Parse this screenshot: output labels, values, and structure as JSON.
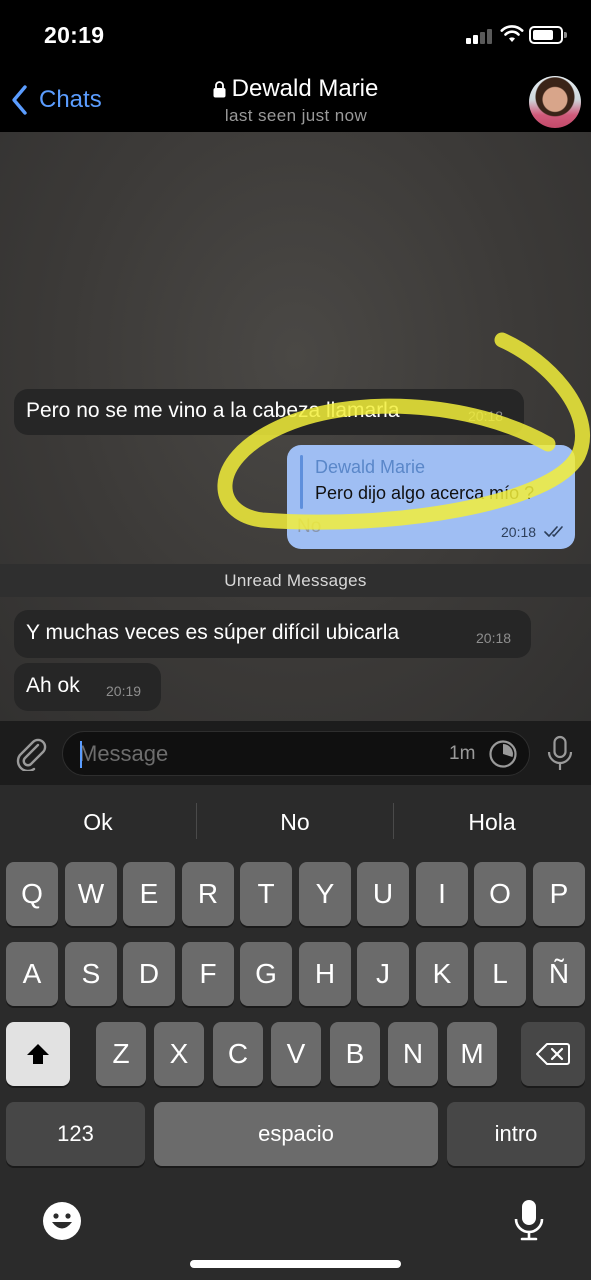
{
  "status_bar": {
    "time": "20:19"
  },
  "nav": {
    "back_label": "Chats",
    "contact_name": "Dewald Marie",
    "last_seen": "last seen just now"
  },
  "messages": [
    {
      "direction": "incoming",
      "text": "Pero no se me vino a la cabeza llamarla",
      "time": "20:18"
    },
    {
      "direction": "outgoing",
      "reply_to_name": "Dewald Marie",
      "reply_to_text": "Pero dijo algo acerca mío ?",
      "text": "No",
      "time": "20:18",
      "status": "read"
    },
    {
      "direction": "incoming",
      "text": "Y muchas veces es súper difícil ubicarla",
      "time": "20:18"
    },
    {
      "direction": "incoming",
      "text": "Ah ok",
      "time": "20:19"
    }
  ],
  "unread_divider": "Unread Messages",
  "composer": {
    "placeholder": "Message",
    "timer_label": "1m"
  },
  "keyboard": {
    "suggestions": [
      "Ok",
      "No",
      "Hola"
    ],
    "row1": [
      "Q",
      "W",
      "E",
      "R",
      "T",
      "Y",
      "U",
      "I",
      "O",
      "P"
    ],
    "row2": [
      "A",
      "S",
      "D",
      "F",
      "G",
      "H",
      "J",
      "K",
      "L",
      "Ñ"
    ],
    "row3": [
      "Z",
      "X",
      "C",
      "V",
      "B",
      "N",
      "M"
    ],
    "numbers_label": "123",
    "space_label": "espacio",
    "return_label": "intro"
  },
  "colors": {
    "accent": "#5b9dff",
    "outgoing_bubble": "#9fbef3",
    "incoming_bubble": "#262626",
    "highlight_marker": "#f2ee3a"
  },
  "icons": [
    "lock-icon",
    "chevron-left-icon",
    "attach-icon",
    "timer-icon",
    "mic-icon",
    "emoji-icon",
    "backspace-icon",
    "shift-icon",
    "double-check-icon"
  ]
}
